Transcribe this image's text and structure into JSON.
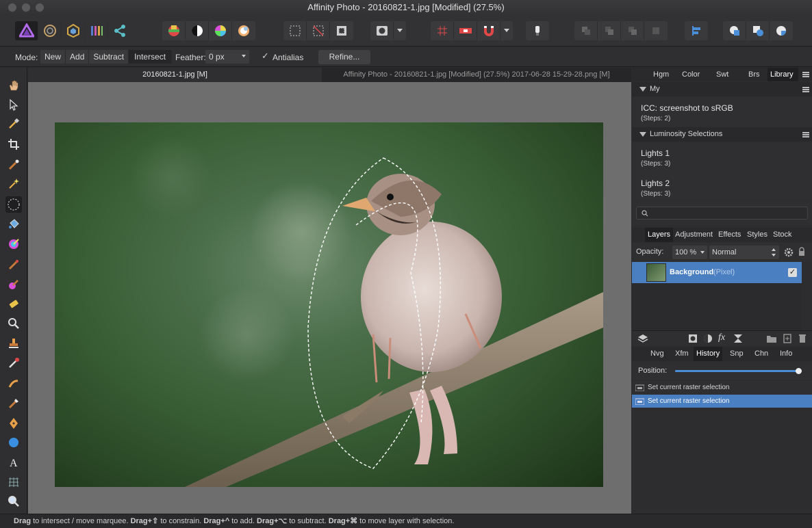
{
  "window": {
    "title": "Affinity Photo - 20160821-1.jpg [Modified] (27.5%)"
  },
  "context_bar": {
    "mode_label": "Mode:",
    "mode_options": [
      "New",
      "Add",
      "Subtract",
      "Intersect"
    ],
    "feather_label": "Feather:",
    "feather_value": "0 px",
    "antialias_label": "Antialias",
    "refine_label": "Refine..."
  },
  "document_tabs": [
    "20160821-1.jpg [M]",
    "Affinity Photo - 20160821-1.jpg [Modified] (27.5%) 2017-06-28 15-29-28.png [M]"
  ],
  "top_panel": {
    "tabs": [
      "Hgm",
      "Color",
      "Swt",
      "Brs",
      "Library"
    ],
    "active_tab": "Library",
    "sections": [
      {
        "title": "My",
        "items": [
          {
            "name": "ICC: screenshot to sRGB",
            "steps": "(Steps: 2)"
          }
        ]
      },
      {
        "title": "Luminosity Selections",
        "items": [
          {
            "name": "Lights 1",
            "steps": "(Steps: 3)"
          },
          {
            "name": "Lights 2",
            "steps": "(Steps: 3)"
          }
        ]
      }
    ]
  },
  "layers_panel": {
    "tabs": [
      "Layers",
      "Adjustment",
      "Effects",
      "Styles",
      "Stock"
    ],
    "active_tab": "Layers",
    "opacity_label": "Opacity:",
    "opacity_value": "100 %",
    "blend_mode": "Normal",
    "layers": [
      {
        "name": "Background",
        "type": "(Pixel)",
        "visible": true
      }
    ]
  },
  "history_panel": {
    "tabs": [
      "Nvg",
      "Xfm",
      "History",
      "Snp",
      "Chn",
      "Info"
    ],
    "active_tab": "History",
    "position_label": "Position:",
    "position_value": 1.0,
    "entries": [
      "Set current raster selection",
      "Set current raster selection"
    ]
  },
  "status_bar": {
    "parts": [
      {
        "b": "Drag",
        "t": " to intersect / move marquee. "
      },
      {
        "b": "Drag+⇧",
        "t": " to constrain. "
      },
      {
        "b": "Drag+^",
        "t": " to add. "
      },
      {
        "b": "Drag+⌥",
        "t": " to subtract. "
      },
      {
        "b": "Drag+⌘",
        "t": " to move layer with selection."
      }
    ]
  },
  "colors": {
    "accent": "#4a7fc1",
    "selection_row": "#4a7fc1"
  }
}
